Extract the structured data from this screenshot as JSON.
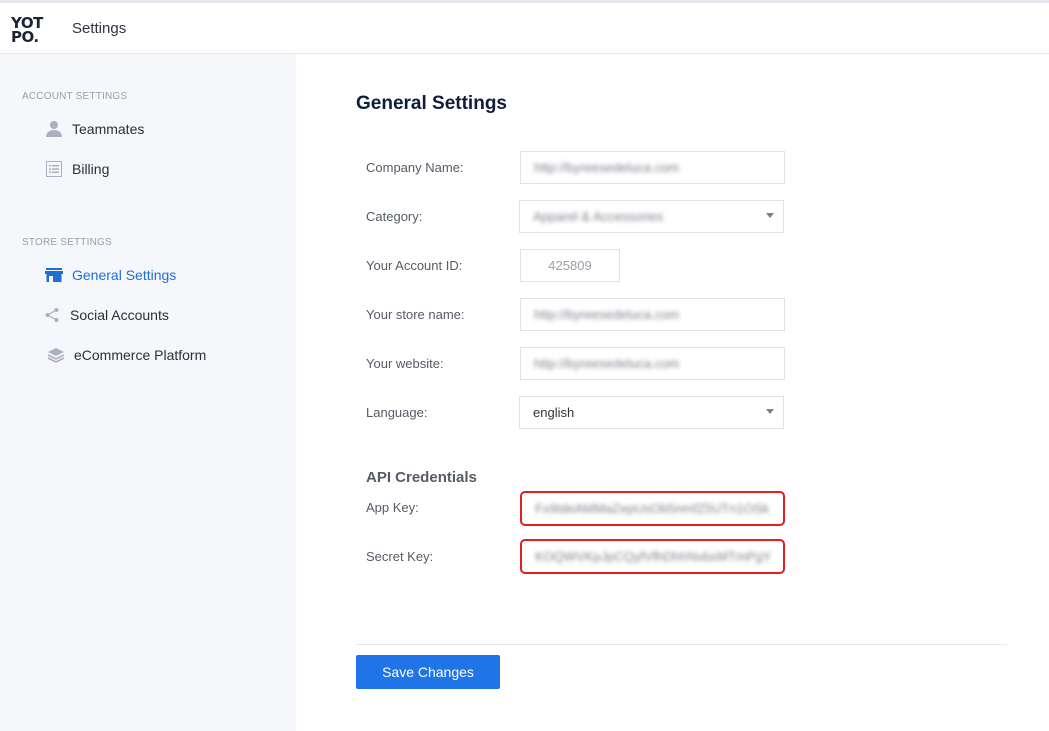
{
  "header": {
    "logo_line1": "YOT",
    "logo_line2": "PO.",
    "title": "Settings"
  },
  "sidebar": {
    "account_section": "ACCOUNT SETTINGS",
    "account_items": [
      {
        "label": "Teammates",
        "icon": "person-icon"
      },
      {
        "label": "Billing",
        "icon": "list-icon"
      }
    ],
    "store_section": "STORE SETTINGS",
    "store_items": [
      {
        "label": "General Settings",
        "icon": "store-icon",
        "active": true
      },
      {
        "label": "Social Accounts",
        "icon": "share-icon"
      },
      {
        "label": "eCommerce Platform",
        "icon": "layers-icon"
      }
    ]
  },
  "main": {
    "title": "General Settings",
    "fields": {
      "company_name": {
        "label": "Company Name:",
        "value": "http://byreesedeluca.com"
      },
      "category": {
        "label": "Category:",
        "value": "Apparel & Accessories"
      },
      "account_id": {
        "label": "Your Account ID:",
        "value": "425809"
      },
      "store_name": {
        "label": "Your store name:",
        "value": "http://byreesedeluca.com"
      },
      "website": {
        "label": "Your website:",
        "value": "http://byreesedeluca.com"
      },
      "language": {
        "label": "Language:",
        "value": "english"
      }
    },
    "api": {
      "title": "API Credentials",
      "app_key_label": "App Key:",
      "app_key_value": "Fx9IdeAMMaZepUsOb5nmfZ5UTn1OSk",
      "secret_key_label": "Secret Key:",
      "secret_key_value": "KOQWVKpJpCQyfVfhDhhNvbxMTmPgY"
    },
    "save_label": "Save Changes"
  },
  "colors": {
    "accent": "#1f74e8",
    "active_nav": "#1f6fd1",
    "highlight_border": "#e02020",
    "sidebar_bg": "#f5f7fb"
  }
}
